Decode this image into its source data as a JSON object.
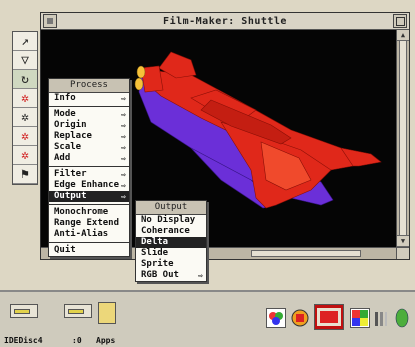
{
  "window": {
    "title": "Film-Maker: Shuttle"
  },
  "palette": {
    "tools": [
      {
        "name": "arrow-tool-icon",
        "glyph": "↗"
      },
      {
        "name": "funnel-tool-icon",
        "glyph": "▽"
      },
      {
        "name": "rotate-tool-icon",
        "glyph": "↻"
      },
      {
        "name": "star-tool-1-icon",
        "glyph": "✲"
      },
      {
        "name": "star-tool-2-icon",
        "glyph": "✲"
      },
      {
        "name": "star-tool-3-icon",
        "glyph": "✲"
      },
      {
        "name": "star-tool-4-icon",
        "glyph": "✲"
      },
      {
        "name": "flag-tool-icon",
        "glyph": "⚑"
      }
    ]
  },
  "process_menu": {
    "title": "Process",
    "items": [
      "Info",
      "Mode",
      "Origin",
      "Replace",
      "Scale",
      "Add",
      "Filter",
      "Edge Enhance",
      "Output",
      "Monochrome",
      "Range Extend",
      "Anti-Alias",
      "Quit"
    ]
  },
  "output_menu": {
    "title": "Output",
    "items": [
      "No Display",
      "Coherance",
      "Delta",
      "Slide",
      "Sprite",
      "RGB Out"
    ]
  },
  "iconbar": {
    "drive1": "IDEDisc4",
    "drive2": ":0",
    "apps": "Apps"
  },
  "colors": {
    "shuttle_red": "#e02a1a",
    "shuttle_shadow": "#6a2ad8",
    "desktop": "#ddd7c4"
  }
}
